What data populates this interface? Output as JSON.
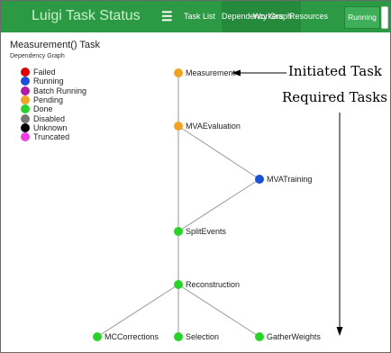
{
  "navbar": {
    "brand": "Luigi Task Status",
    "menu_icon": "hamburger-icon",
    "tabs": [
      {
        "label": "Task List",
        "active": false
      },
      {
        "label": "Dependency Graph",
        "active": true
      },
      {
        "label": "Workers",
        "active": false
      },
      {
        "label": "Resources",
        "active": false
      }
    ],
    "status_button": "Running"
  },
  "page": {
    "task_title": "Measurement() Task",
    "subtitle": "Dependency Graph"
  },
  "legend": [
    {
      "label": "Failed",
      "color": "#dd0000"
    },
    {
      "label": "Running",
      "color": "#1a4fd6"
    },
    {
      "label": "Batch Running",
      "color": "#b01ba8"
    },
    {
      "label": "Pending",
      "color": "#f0a427"
    },
    {
      "label": "Done",
      "color": "#2bd22b"
    },
    {
      "label": "Disabled",
      "color": "#777777"
    },
    {
      "label": "Unknown",
      "color": "#000000"
    },
    {
      "label": "Truncated",
      "color": "#f03ee0"
    }
  ],
  "graph": {
    "nodes": [
      {
        "id": "measurement",
        "label": "Measurement",
        "status": "Pending"
      },
      {
        "id": "mvaevaluation",
        "label": "MVAEvaluation",
        "status": "Pending"
      },
      {
        "id": "mvatraining",
        "label": "MVATraining",
        "status": "Running"
      },
      {
        "id": "splitevents",
        "label": "SplitEvents",
        "status": "Done"
      },
      {
        "id": "reconstruction",
        "label": "Reconstruction",
        "status": "Done"
      },
      {
        "id": "mccorrections",
        "label": "MCCorrections",
        "status": "Done"
      },
      {
        "id": "selection",
        "label": "Selection",
        "status": "Done"
      },
      {
        "id": "gatherweights",
        "label": "GatherWeights",
        "status": "Done"
      }
    ],
    "edges": [
      [
        "measurement",
        "mvaevaluation"
      ],
      [
        "mvaevaluation",
        "mvatraining"
      ],
      [
        "mvaevaluation",
        "splitevents"
      ],
      [
        "mvatraining",
        "splitevents"
      ],
      [
        "splitevents",
        "reconstruction"
      ],
      [
        "reconstruction",
        "mccorrections"
      ],
      [
        "reconstruction",
        "selection"
      ],
      [
        "reconstruction",
        "gatherweights"
      ]
    ]
  },
  "annotations": {
    "initiated": "Initiated Task",
    "required": "Required Tasks"
  }
}
